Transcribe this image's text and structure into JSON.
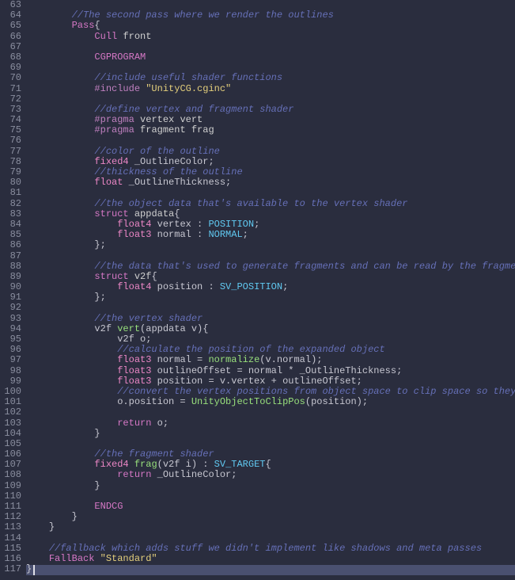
{
  "editor": {
    "startLine": 63,
    "endLine": 117,
    "currentLineIndex": 54,
    "caretColumnCh": 1
  },
  "colors": {
    "bg": "#2a2d3e",
    "gutter": "#8a8e9f",
    "currentLine": "#4a5070",
    "comment": "#6670b8",
    "keyword": "#d678c6",
    "type": "#ec87c6",
    "func": "#98e07c",
    "semantic": "#60c8f0",
    "string": "#e4cf7c",
    "default": "#c7c7d1"
  },
  "lines": [
    [],
    [
      [
        "sp",
        "        "
      ],
      [
        "comment",
        "//The second pass where we render the outlines"
      ]
    ],
    [
      [
        "sp",
        "        "
      ],
      [
        "keyword",
        "Pass"
      ],
      [
        "brace",
        "{"
      ]
    ],
    [
      [
        "sp",
        "            "
      ],
      [
        "keyword",
        "Cull"
      ],
      [
        "default",
        " "
      ],
      [
        "ident",
        "front"
      ]
    ],
    [],
    [
      [
        "sp",
        "            "
      ],
      [
        "keyword",
        "CGPROGRAM"
      ]
    ],
    [],
    [
      [
        "sp",
        "            "
      ],
      [
        "comment",
        "//include useful shader functions"
      ]
    ],
    [
      [
        "sp",
        "            "
      ],
      [
        "preproc",
        "#include"
      ],
      [
        "default",
        " "
      ],
      [
        "string",
        "\"UnityCG.cginc\""
      ]
    ],
    [],
    [
      [
        "sp",
        "            "
      ],
      [
        "comment",
        "//define vertex and fragment shader"
      ]
    ],
    [
      [
        "sp",
        "            "
      ],
      [
        "pragma",
        "#pragma"
      ],
      [
        "default",
        " "
      ],
      [
        "ident",
        "vertex vert"
      ]
    ],
    [
      [
        "sp",
        "            "
      ],
      [
        "pragma",
        "#pragma"
      ],
      [
        "default",
        " "
      ],
      [
        "ident",
        "fragment frag"
      ]
    ],
    [],
    [
      [
        "sp",
        "            "
      ],
      [
        "comment",
        "//color of the outline"
      ]
    ],
    [
      [
        "sp",
        "            "
      ],
      [
        "type",
        "fixed4"
      ],
      [
        "default",
        " _OutlineColor;"
      ]
    ],
    [
      [
        "sp",
        "            "
      ],
      [
        "comment",
        "//thickness of the outline"
      ]
    ],
    [
      [
        "sp",
        "            "
      ],
      [
        "type",
        "float"
      ],
      [
        "default",
        " _OutlineThickness;"
      ]
    ],
    [],
    [
      [
        "sp",
        "            "
      ],
      [
        "comment",
        "//the object data that's available to the vertex shader"
      ]
    ],
    [
      [
        "sp",
        "            "
      ],
      [
        "keyword",
        "struct"
      ],
      [
        "default",
        " "
      ],
      [
        "ident",
        "appdata"
      ],
      [
        "brace",
        "{"
      ]
    ],
    [
      [
        "sp",
        "                "
      ],
      [
        "type",
        "float4"
      ],
      [
        "default",
        " vertex : "
      ],
      [
        "semantic",
        "POSITION"
      ],
      [
        "default",
        ";"
      ]
    ],
    [
      [
        "sp",
        "                "
      ],
      [
        "type",
        "float3"
      ],
      [
        "default",
        " normal : "
      ],
      [
        "semantic",
        "NORMAL"
      ],
      [
        "default",
        ";"
      ]
    ],
    [
      [
        "sp",
        "            "
      ],
      [
        "brace",
        "};"
      ]
    ],
    [],
    [
      [
        "sp",
        "            "
      ],
      [
        "comment",
        "//the data that's used to generate fragments and can be read by the fragment shader"
      ]
    ],
    [
      [
        "sp",
        "            "
      ],
      [
        "keyword",
        "struct"
      ],
      [
        "default",
        " "
      ],
      [
        "ident",
        "v2f"
      ],
      [
        "brace",
        "{"
      ]
    ],
    [
      [
        "sp",
        "                "
      ],
      [
        "type",
        "float4"
      ],
      [
        "default",
        " position : "
      ],
      [
        "semantic",
        "SV_POSITION"
      ],
      [
        "default",
        ";"
      ]
    ],
    [
      [
        "sp",
        "            "
      ],
      [
        "brace",
        "};"
      ]
    ],
    [],
    [
      [
        "sp",
        "            "
      ],
      [
        "comment",
        "//the vertex shader"
      ]
    ],
    [
      [
        "sp",
        "            "
      ],
      [
        "default",
        "v2f "
      ],
      [
        "func",
        "vert"
      ],
      [
        "default",
        "(appdata v)"
      ],
      [
        "brace",
        "{"
      ]
    ],
    [
      [
        "sp",
        "                "
      ],
      [
        "default",
        "v2f o;"
      ]
    ],
    [
      [
        "sp",
        "                "
      ],
      [
        "comment",
        "//calculate the position of the expanded object"
      ]
    ],
    [
      [
        "sp",
        "                "
      ],
      [
        "type",
        "float3"
      ],
      [
        "default",
        " normal = "
      ],
      [
        "func",
        "normalize"
      ],
      [
        "default",
        "(v.normal);"
      ]
    ],
    [
      [
        "sp",
        "                "
      ],
      [
        "type",
        "float3"
      ],
      [
        "default",
        " outlineOffset = normal * _OutlineThickness;"
      ]
    ],
    [
      [
        "sp",
        "                "
      ],
      [
        "type",
        "float3"
      ],
      [
        "default",
        " position = v.vertex + outlineOffset;"
      ]
    ],
    [
      [
        "sp",
        "                "
      ],
      [
        "comment",
        "//convert the vertex positions from object space to clip space so they can be rendered"
      ]
    ],
    [
      [
        "sp",
        "                "
      ],
      [
        "default",
        "o.position = "
      ],
      [
        "func",
        "UnityObjectToClipPos"
      ],
      [
        "default",
        "(position);"
      ]
    ],
    [],
    [
      [
        "sp",
        "                "
      ],
      [
        "keyword",
        "return"
      ],
      [
        "default",
        " o;"
      ]
    ],
    [
      [
        "sp",
        "            "
      ],
      [
        "brace",
        "}"
      ]
    ],
    [],
    [
      [
        "sp",
        "            "
      ],
      [
        "comment",
        "//the fragment shader"
      ]
    ],
    [
      [
        "sp",
        "            "
      ],
      [
        "type",
        "fixed4"
      ],
      [
        "default",
        " "
      ],
      [
        "func",
        "frag"
      ],
      [
        "default",
        "(v2f i) : "
      ],
      [
        "semantic",
        "SV_TARGET"
      ],
      [
        "brace",
        "{"
      ]
    ],
    [
      [
        "sp",
        "                "
      ],
      [
        "keyword",
        "return"
      ],
      [
        "default",
        " _OutlineColor;"
      ]
    ],
    [
      [
        "sp",
        "            "
      ],
      [
        "brace",
        "}"
      ]
    ],
    [],
    [
      [
        "sp",
        "            "
      ],
      [
        "keyword",
        "ENDCG"
      ]
    ],
    [
      [
        "sp",
        "        "
      ],
      [
        "brace",
        "}"
      ]
    ],
    [
      [
        "sp",
        "    "
      ],
      [
        "brace",
        "}"
      ]
    ],
    [],
    [
      [
        "sp",
        "    "
      ],
      [
        "comment",
        "//fallback which adds stuff we didn't implement like shadows and meta passes"
      ]
    ],
    [
      [
        "sp",
        "    "
      ],
      [
        "keyword",
        "FallBack"
      ],
      [
        "default",
        " "
      ],
      [
        "string",
        "\"Standard\""
      ]
    ],
    [
      [
        "brace",
        "}"
      ]
    ]
  ]
}
